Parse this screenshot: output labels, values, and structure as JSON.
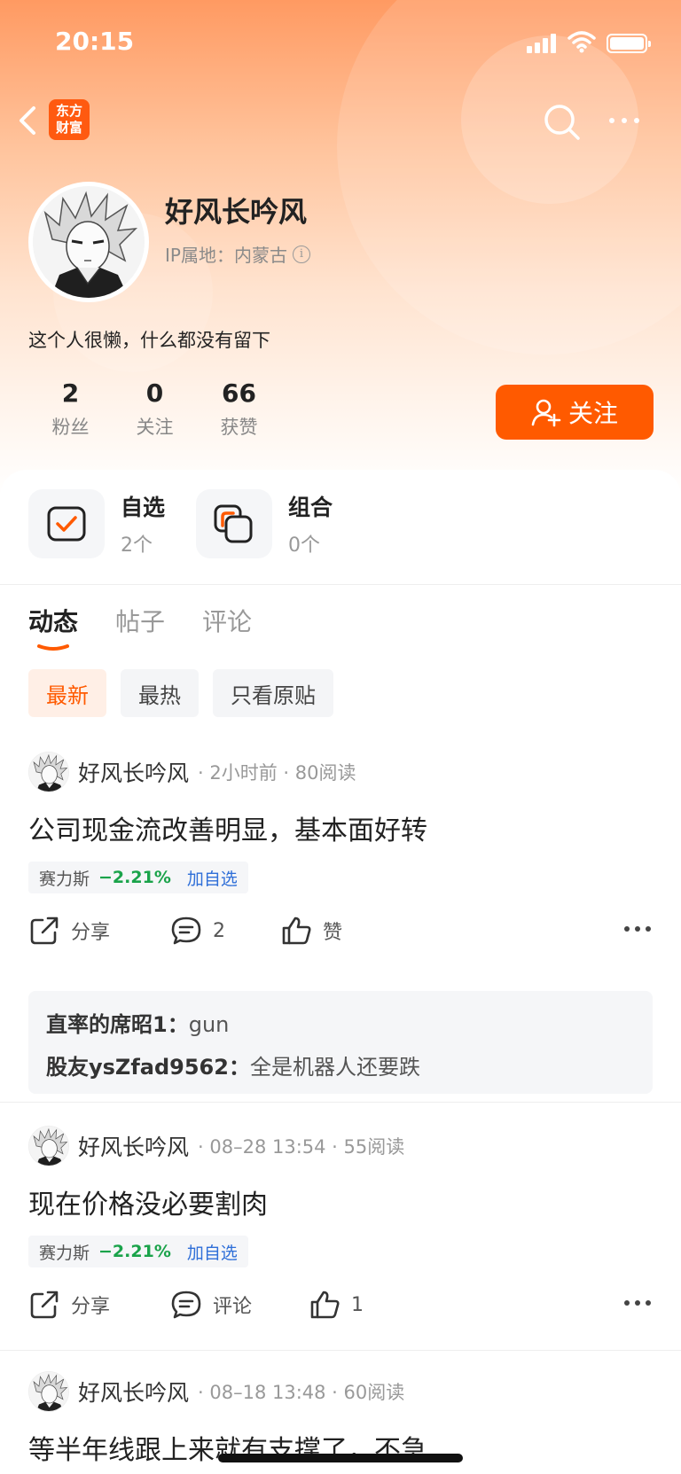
{
  "status_bar": {
    "time": "20:15"
  },
  "nav": {
    "logo_line1": "东方",
    "logo_line2": "财富"
  },
  "profile": {
    "name": "好风长吟风",
    "ip_location": "IP属地：内蒙古",
    "bio": "这个人很懒，什么都没有留下",
    "stats": [
      {
        "value": "2",
        "label": "粉丝"
      },
      {
        "value": "0",
        "label": "关注"
      },
      {
        "value": "66",
        "label": "获赞"
      }
    ],
    "follow_label": "关注"
  },
  "shortcuts": [
    {
      "title": "自选",
      "sub": "2个",
      "icon": "checklist-icon"
    },
    {
      "title": "组合",
      "sub": "0个",
      "icon": "portfolio-icon"
    }
  ],
  "tabs": [
    "动态",
    "帖子",
    "评论"
  ],
  "filters": [
    "最新",
    "最热",
    "只看原贴"
  ],
  "posts": [
    {
      "author": "好风长吟风",
      "meta": "· 2小时前 · 80阅读",
      "title": "公司现金流改善明显，基本面好转",
      "stock": {
        "name": "赛力斯",
        "change": "−2.21%",
        "add": "加自选"
      },
      "share": "分享",
      "comment": "2",
      "like": "赞",
      "comments": [
        {
          "who": "直率的席昭1",
          "text": "gun"
        },
        {
          "who": "股友ysZfad9562",
          "text": "全是机器人还要跌"
        }
      ]
    },
    {
      "author": "好风长吟风",
      "meta": "· 08–28 13:54 · 55阅读",
      "title": "现在价格没必要割肉",
      "stock": {
        "name": "赛力斯",
        "change": "−2.21%",
        "add": "加自选"
      },
      "share": "分享",
      "comment": "评论",
      "like": "1"
    },
    {
      "author": "好风长吟风",
      "meta": "· 08–18 13:48 · 60阅读",
      "title": "等半年线跟上来就有支撑了，不急"
    }
  ],
  "colors": {
    "accent": "#ff5a00",
    "down": "#1aa34a",
    "link": "#2f6fd8"
  }
}
